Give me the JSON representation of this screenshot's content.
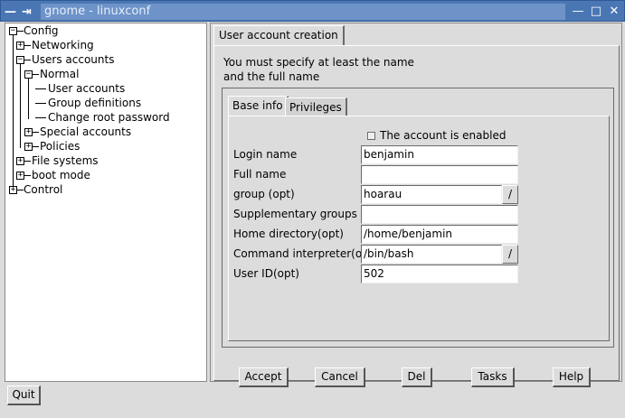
{
  "window": {
    "title": "gnome - linuxconf",
    "left_glyphs": [
      "—",
      "⇥"
    ],
    "right_glyphs": [
      "—",
      "□",
      "✕"
    ]
  },
  "tree": {
    "config": "Config",
    "networking": "Networking",
    "users_accounts": "Users accounts",
    "normal": "Normal",
    "user_accounts": "User accounts",
    "group_definitions": "Group definitions",
    "change_root_password": "Change root password",
    "special_accounts": "Special accounts",
    "policies": "Policies",
    "file_systems": "File systems",
    "boot_mode": "boot mode",
    "control": "Control",
    "expander_minus": "−",
    "expander_plus": "+"
  },
  "main_tab": "User account creation",
  "message_line1": "You must specify at least the name",
  "message_line2": "and the full name",
  "inner_tabs": {
    "base_info": "Base info",
    "privileges": "Privileges"
  },
  "form": {
    "enabled_label": "The account is enabled",
    "login_name_label": "Login name",
    "login_name_value": "benjamin",
    "full_name_label": "Full name",
    "full_name_value": "",
    "group_label": "group (opt)",
    "group_value": "hoarau",
    "supp_groups_label": "Supplementary groups",
    "supp_groups_value": "",
    "home_dir_label": "Home directory(opt)",
    "home_dir_value": "/home/benjamin",
    "shell_label": "Command interpreter(opt)",
    "shell_value": "/bin/bash",
    "uid_label": "User ID(opt)",
    "uid_value": "502",
    "combo_arrow": "/"
  },
  "buttons": {
    "accept": "Accept",
    "cancel": "Cancel",
    "del": "Del",
    "tasks": "Tasks",
    "help": "Help",
    "quit": "Quit"
  }
}
